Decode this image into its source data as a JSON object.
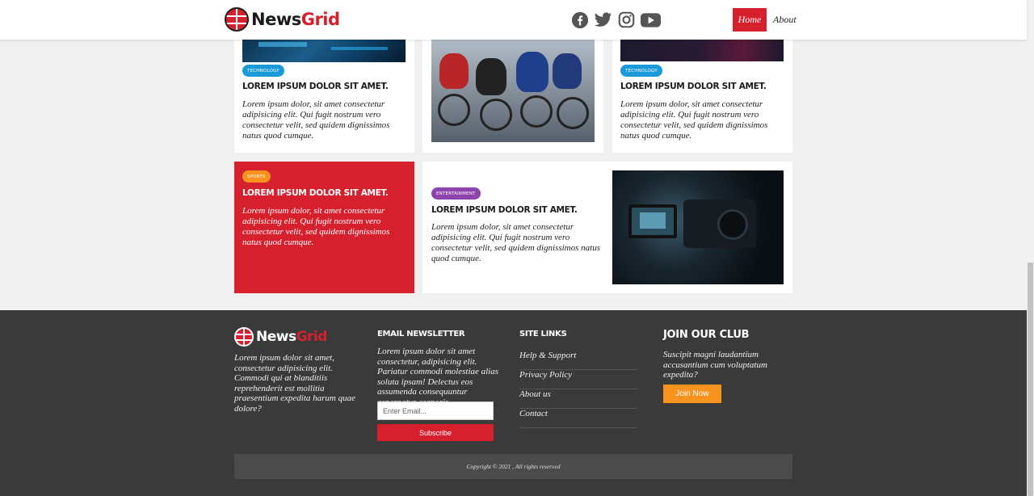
{
  "header": {
    "logo_part1": "News",
    "logo_part2": "Grid",
    "social": [
      "facebook-icon",
      "twitter-icon",
      "instagram-icon",
      "youtube-icon"
    ],
    "nav": {
      "home": "Home",
      "about": "About"
    }
  },
  "cards": {
    "card1": {
      "badge": "TECHNOLOGY",
      "title": "LOREM IPSUM DOLOR SIT AMET.",
      "text": "Lorem ipsum dolor, sit amet consectetur adipisicing elit. Qui fugit nostrum vero consectetur velit, sed quidem dignissimos natus quod cumque."
    },
    "card3": {
      "badge": "TECHNOLOGY",
      "title": "LOREM IPSUM DOLOR SIT AMET.",
      "text": "Lorem ipsum dolor, sit amet consectetur adipisicing elit. Qui fugit nostrum vero consectetur velit, sed quidem dignissimos natus quod cumque."
    },
    "card4": {
      "badge": "SPORTS",
      "title": "LOREM IPSUM DOLOR SIT AMET.",
      "text": "Lorem ipsum dolor, sit amet consectetur adipisicing elit. Qui fugit nostrum vero consectetur velit, sed quidem dignissimos natus quod cumque."
    },
    "card5": {
      "badge": "ENTERTAINMENT",
      "title": "LOREM IPSUM DOLOR SIT AMET.",
      "text": "Lorem ipsum dolor, sit amet consectetur adipisicing elit. Qui fugit nostrum vero consectetur velit, sed quidem dignissimos natus quod cumque."
    }
  },
  "footer": {
    "logo_part1": "News",
    "logo_part2": "Grid",
    "about_text": "Lorem ipsum dolor sit amet, consectetur adipisicing elit. Commodi qui at blanditiis reprehenderit est mollitia praesentium expedita harum quae dolore?",
    "newsletter": {
      "heading": "EMAIL NEWSLETTER",
      "text": "Lorem ipsum dolor sit amet consectetur, adipisicing elit. Pariatur commodi molestiae alias soluta ipsam! Delectus eos assumenda consequuntur aspernatur corporis.",
      "placeholder": "Enter Email...",
      "button": "Subscribe"
    },
    "links": {
      "heading": "SITE LINKS",
      "items": [
        "Help & Support",
        "Privacy Policy",
        "About us",
        "Contact"
      ]
    },
    "club": {
      "heading": "JOIN OUR CLUB",
      "text": "Suscipit magni laudantium accusantium cum voluptatum expedita?",
      "button": "Join Now"
    },
    "copyright": "Copyright © 2021 , All rights reserved"
  },
  "colors": {
    "brand_red": "#d6202e",
    "technology": "#1a9ad7",
    "sports": "#f7931e",
    "entertainment": "#8e44ad",
    "footer_bg": "#3a3a3a"
  }
}
